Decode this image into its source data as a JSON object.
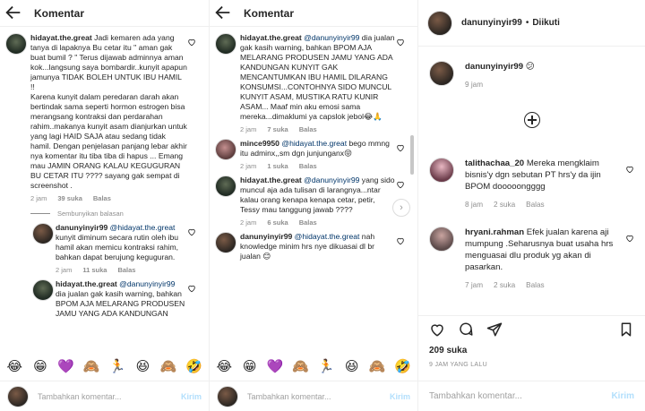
{
  "left": {
    "title": "Komentar",
    "comments": [
      {
        "user": "hidayat.the.great",
        "text": "Jadi kemaren ada yang tanya di lapaknya Bu cetar itu \" aman gak buat bumil ? \" Terus dijawab adminnya aman kok...langsung saya bombardir..kunyit apapun jamunya TIDAK BOLEH UNTUK IBU HAMIL !!\nKarena kunyit dalam peredaran darah akan bertindak sama seperti hormon estrogen bisa merangsang kontraksi dan perdarahan rahim..makanya kunyit asam dianjurkan untuk yang lagi HAID SAJA atau sedang tidak hamil. Dengan penjelasan panjang lebar akhir nya komentar itu tiba tiba di hapus ... Emang mau JAMIN ORANG KALAU KEGUGURAN BU CETAR ITU ???? sayang gak sempat di screenshot .",
        "time": "2 jam",
        "likes": "39 suka",
        "reply": "Balas"
      },
      {
        "user": "danunyinyir99",
        "mention": "@hidayat.the.great",
        "text": "kunyit diminum secara rutin oleh ibu hamil akan memicu kontraksi rahim, bahkan dapat berujung keguguran.",
        "time": "2 jam",
        "likes": "11 suka",
        "reply": "Balas"
      },
      {
        "user": "hidayat.the.great",
        "mention": "@danunyinyir99",
        "text": "dia jualan gak kasih warning, bahkan BPOM AJA MELARANG PRODUSEN JAMU YANG ADA KANDUNGAN",
        "time": "",
        "likes": "",
        "reply": ""
      }
    ],
    "hide_replies": "Sembunyikan balasan",
    "composer_placeholder": "Tambahkan komentar...",
    "send_label": "Kirim"
  },
  "middle": {
    "title": "Komentar",
    "comments": [
      {
        "user": "hidayat.the.great",
        "mention": "@danunyinyir99",
        "text": "dia jualan gak kasih warning, bahkan BPOM AJA MELARANG PRODUSEN JAMU YANG ADA KANDUNGAN KUNYIT GAK MENCANTUMKAN IBU HAMIL DILARANG KONSUMSI...CONTOHNYA SIDO MUNCUL KUNYIT ASAM, MUSTIKA RATU KUNIR ASAM... Maaf min aku emosi sama mereka...dimaklumi ya capslok jebol😂🙏",
        "time": "2 jam",
        "likes": "7 suka",
        "reply": "Balas"
      },
      {
        "user": "mince9950",
        "mention": "@hidayat.the.great",
        "text": "bego mmng itu adminx,,sm dgn junjunganx😝",
        "time": "2 jam",
        "likes": "1 suka",
        "reply": "Balas"
      },
      {
        "user": "hidayat.the.great",
        "mention": "@danunyinyir99",
        "text": "yang sido muncul aja ada tulisan di larangnya...ntar kalau orang kenapa kenapa cetar, petir, Tessy mau tanggung jawab ????",
        "time": "2 jam",
        "likes": "6 suka",
        "reply": "Balas"
      },
      {
        "user": "danunyinyir99",
        "mention": "@hidayat.the.great",
        "text": "nah knowledge minim hrs nye dikuasai dl br jualan 😊",
        "time": "",
        "likes": "",
        "reply": ""
      }
    ],
    "composer_placeholder": "Tambahkan komentar...",
    "send_label": "Kirim"
  },
  "emojis": [
    "😂",
    "😁",
    "💜",
    "🙈",
    "🏃",
    "😆",
    "🙈",
    "🤣"
  ],
  "right": {
    "username": "danunyinyir99",
    "dot": "•",
    "follow_status": "Diikuti",
    "caption_user": "danunyinyir99",
    "caption_text": "😕",
    "caption_time": "9 jam",
    "comments": [
      {
        "user": "talithachaa_20",
        "text": "Mereka mengklaim bisnis'y dgn sebutan PT hrs'y da ijin BPOM dooooongggg",
        "time": "8 jam",
        "likes": "2 suka",
        "reply": "Balas"
      },
      {
        "user": "hryani.rahman",
        "text": "Efek jualan karena aji mumpung .Seharusnya buat usaha hrs menguasai dlu produk yg akan di pasarkan.",
        "time": "7 jam",
        "likes": "2 suka",
        "reply": "Balas"
      }
    ],
    "likes": "209 suka",
    "when": "9 JAM YANG LALU",
    "composer_placeholder": "Tambahkan komentar...",
    "send_label": "Kirim"
  }
}
